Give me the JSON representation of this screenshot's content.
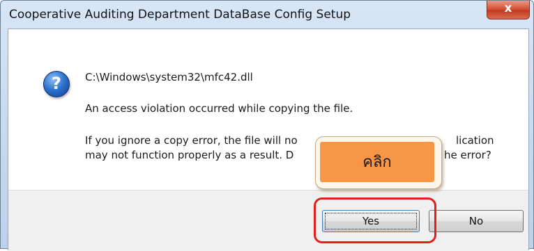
{
  "window": {
    "title": "Cooperative Auditing Department DataBase Config Setup",
    "close_label": "x"
  },
  "dialog": {
    "icon": "question-icon",
    "icon_glyph": "?",
    "file_path": "C:\\Windows\\system32\\mfc42.dll",
    "message": "An access violation occurred while copying the file.",
    "detail_line1_left": "If you ignore a copy error, the file will no",
    "detail_line1_right": "lication",
    "detail_line2_left": "may not function properly as a result.  D",
    "detail_line2_right": "he error?"
  },
  "buttons": {
    "yes_label": "Yes",
    "no_label": "No"
  },
  "annotation": {
    "callout_text": "คลิก",
    "highlight_color": "#e0201b",
    "callout_color": "#f79646"
  }
}
